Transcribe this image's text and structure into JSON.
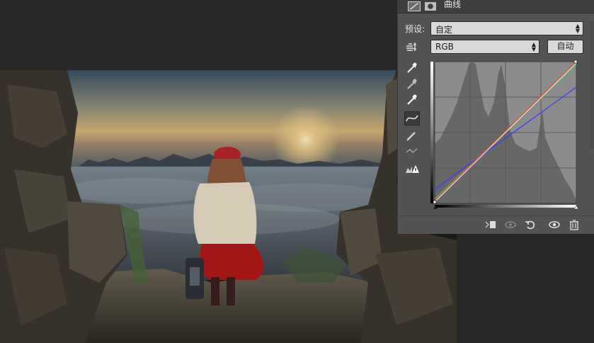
{
  "panel": {
    "title": "曲线",
    "preset_label": "预设:",
    "preset_value": "自定",
    "channel_value": "RGB",
    "auto_button": "自动"
  },
  "colors": {
    "workspace_bg": "#282828",
    "panel_bg": "#535353",
    "graph_bg": "#727272",
    "curve_rgb": "#e0e0e0",
    "curve_red": "#ff4040",
    "curve_green": "#40d040",
    "curve_blue": "#3a3aff"
  },
  "icons": {
    "header": [
      "curves-adjustment-icon",
      "layer-mask-icon"
    ],
    "tools": [
      "hand-adjust-icon",
      "eyedropper-black-icon",
      "eyedropper-gray-icon",
      "eyedropper-white-icon",
      "curve-edit-icon",
      "pencil-icon",
      "smooth-icon",
      "clipping-warning-icon"
    ],
    "bottom": [
      "clip-to-layer-icon",
      "view-previous-icon",
      "reset-icon",
      "visibility-eye-icon",
      "trash-icon"
    ]
  }
}
